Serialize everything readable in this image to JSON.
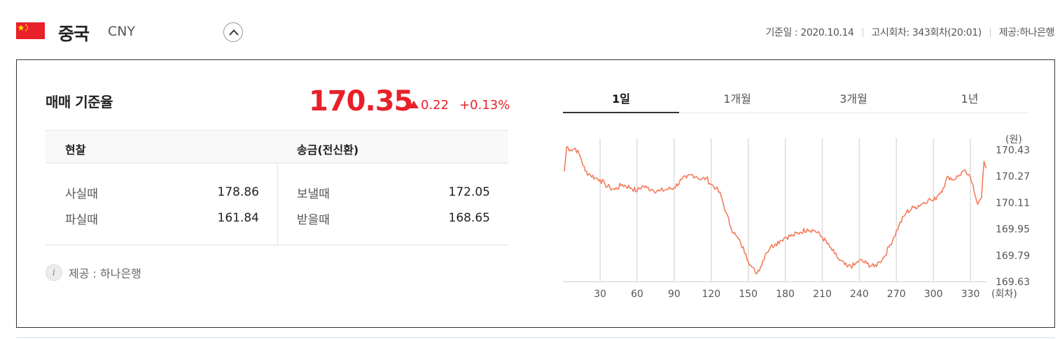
{
  "header": {
    "country": "중국",
    "currency_code": "CNY",
    "base_date": "기준일 : 2020.10.14",
    "notice_round": "고시회차: 343회차(20:01)",
    "provider": "제공:하나은행"
  },
  "rate": {
    "title": "매매 기준율",
    "value": "170.35",
    "change": "0.22",
    "change_pct": "+0.13%",
    "direction": "up"
  },
  "table": {
    "cash_header": "현찰",
    "transfer_header": "송금(전신환)",
    "buy_label": "사실때",
    "buy_value": "178.86",
    "sell_label": "파실때",
    "sell_value": "161.84",
    "send_label": "보낼때",
    "send_value": "172.05",
    "receive_label": "받을때",
    "receive_value": "168.65"
  },
  "source": "제공 : 하나은행",
  "tabs": [
    {
      "label": "1일",
      "active": true
    },
    {
      "label": "1개월",
      "active": false
    },
    {
      "label": "3개월",
      "active": false
    },
    {
      "label": "1년",
      "active": false
    }
  ],
  "colors": {
    "accent": "#e8202a",
    "line": "#f47c5b"
  },
  "chart_data": {
    "type": "line",
    "ylabel": "(원)",
    "xlabel": "(회차)",
    "xlim": [
      1,
      343
    ],
    "ylim": [
      169.63,
      170.5
    ],
    "x_ticks": [
      30,
      60,
      90,
      120,
      150,
      180,
      210,
      240,
      270,
      300,
      330
    ],
    "y_ticks": [
      170.43,
      170.27,
      170.11,
      169.95,
      169.79,
      169.63
    ],
    "grid": "vertical",
    "series": [
      {
        "x": [
          1,
          3,
          6,
          10,
          14,
          18,
          22,
          26,
          30,
          34,
          38,
          42,
          48,
          55,
          60,
          64,
          68,
          72,
          78,
          84,
          90,
          96,
          100,
          104,
          108,
          112,
          116,
          120,
          124,
          128,
          132,
          136,
          140,
          144,
          148,
          152,
          156,
          160,
          164,
          168,
          172,
          176,
          180,
          186,
          192,
          198,
          204,
          210,
          216,
          220,
          224,
          230,
          236,
          240,
          246,
          252,
          256,
          260,
          264,
          268,
          272,
          278,
          284,
          290,
          296,
          300,
          304,
          308,
          312,
          316,
          320,
          324,
          328,
          332,
          336,
          339,
          341,
          343
        ],
        "y": [
          170.3,
          170.45,
          170.43,
          170.44,
          170.39,
          170.3,
          170.28,
          170.26,
          170.25,
          170.22,
          170.2,
          170.19,
          170.22,
          170.2,
          170.18,
          170.21,
          170.2,
          170.19,
          170.18,
          170.19,
          170.2,
          170.25,
          170.26,
          170.28,
          170.27,
          170.25,
          170.26,
          170.22,
          170.2,
          170.15,
          170.05,
          169.96,
          169.91,
          169.86,
          169.8,
          169.73,
          169.68,
          169.72,
          169.8,
          169.84,
          169.86,
          169.88,
          169.9,
          169.91,
          169.93,
          169.95,
          169.94,
          169.9,
          169.84,
          169.8,
          169.76,
          169.72,
          169.73,
          169.76,
          169.74,
          169.72,
          169.75,
          169.78,
          169.84,
          169.9,
          169.97,
          170.05,
          170.08,
          170.1,
          170.13,
          170.12,
          170.16,
          170.2,
          170.27,
          170.25,
          170.27,
          170.3,
          170.28,
          170.22,
          170.1,
          170.14,
          170.36,
          170.32
        ]
      }
    ]
  }
}
